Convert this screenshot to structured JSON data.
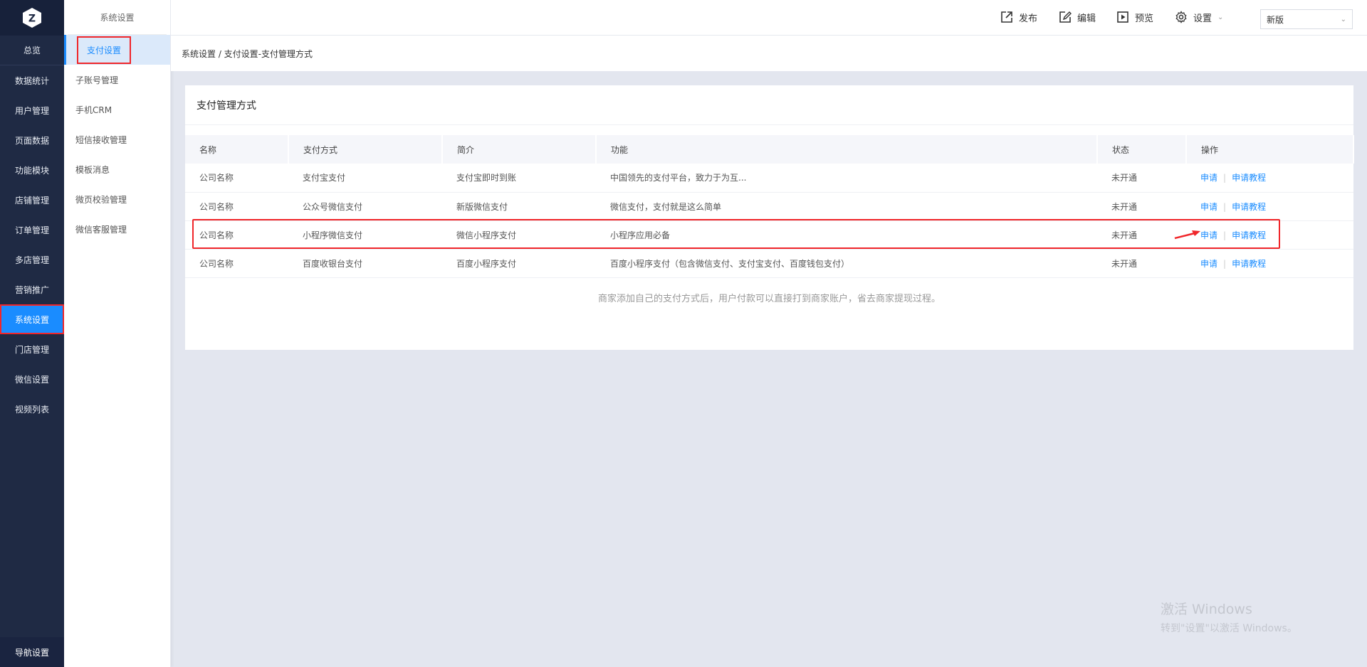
{
  "brand": {
    "logo_letter": "Z"
  },
  "primary_nav": {
    "overview": "总览",
    "items": [
      "数据统计",
      "用户管理",
      "页面数据",
      "功能模块",
      "店铺管理",
      "订单管理",
      "多店管理",
      "营销推广",
      "系统设置",
      "门店管理",
      "微信设置",
      "视频列表"
    ],
    "active": "系统设置",
    "bottom": "导航设置"
  },
  "secondary_nav": {
    "title": "系统设置",
    "items": [
      "支付设置",
      "子账号管理",
      "手机CRM",
      "短信接收管理",
      "模板消息",
      "微页校验管理",
      "微信客服管理"
    ],
    "active": "支付设置"
  },
  "topbar": {
    "publish": "发布",
    "edit": "编辑",
    "preview": "预览",
    "settings": "设置",
    "version_select": "新版"
  },
  "breadcrumb": "系统设置 / 支付设置-支付管理方式",
  "card": {
    "title": "支付管理方式",
    "columns": [
      "名称",
      "支付方式",
      "简介",
      "功能",
      "状态",
      "操作"
    ],
    "rows": [
      {
        "name": "公司名称",
        "method": "支付宝支付",
        "intro": "支付宝即时到账",
        "feature": "中国领先的支付平台，致力于为互...",
        "status": "未开通",
        "apply": "申请",
        "tutorial": "申请教程"
      },
      {
        "name": "公司名称",
        "method": "公众号微信支付",
        "intro": "新版微信支付",
        "feature": "微信支付，支付就是这么简单",
        "status": "未开通",
        "apply": "申请",
        "tutorial": "申请教程"
      },
      {
        "name": "公司名称",
        "method": "小程序微信支付",
        "intro": "微信小程序支付",
        "feature": "小程序应用必备",
        "status": "未开通",
        "apply": "申请",
        "tutorial": "申请教程"
      },
      {
        "name": "公司名称",
        "method": "百度收银台支付",
        "intro": "百度小程序支付",
        "feature": "百度小程序支付（包含微信支付、支付宝支付、百度钱包支付）",
        "status": "未开通",
        "apply": "申请",
        "tutorial": "申请教程"
      }
    ],
    "note": "商家添加自己的支付方式后，用户付款可以直接打到商家账户，省去商家提现过程。"
  },
  "watermark": {
    "line1": "激活 Windows",
    "line2": "转到\"设置\"以激活 Windows。"
  },
  "colors": {
    "accent": "#1a8cff",
    "sidebar": "#1f2a44",
    "highlight": "#f0262a"
  }
}
